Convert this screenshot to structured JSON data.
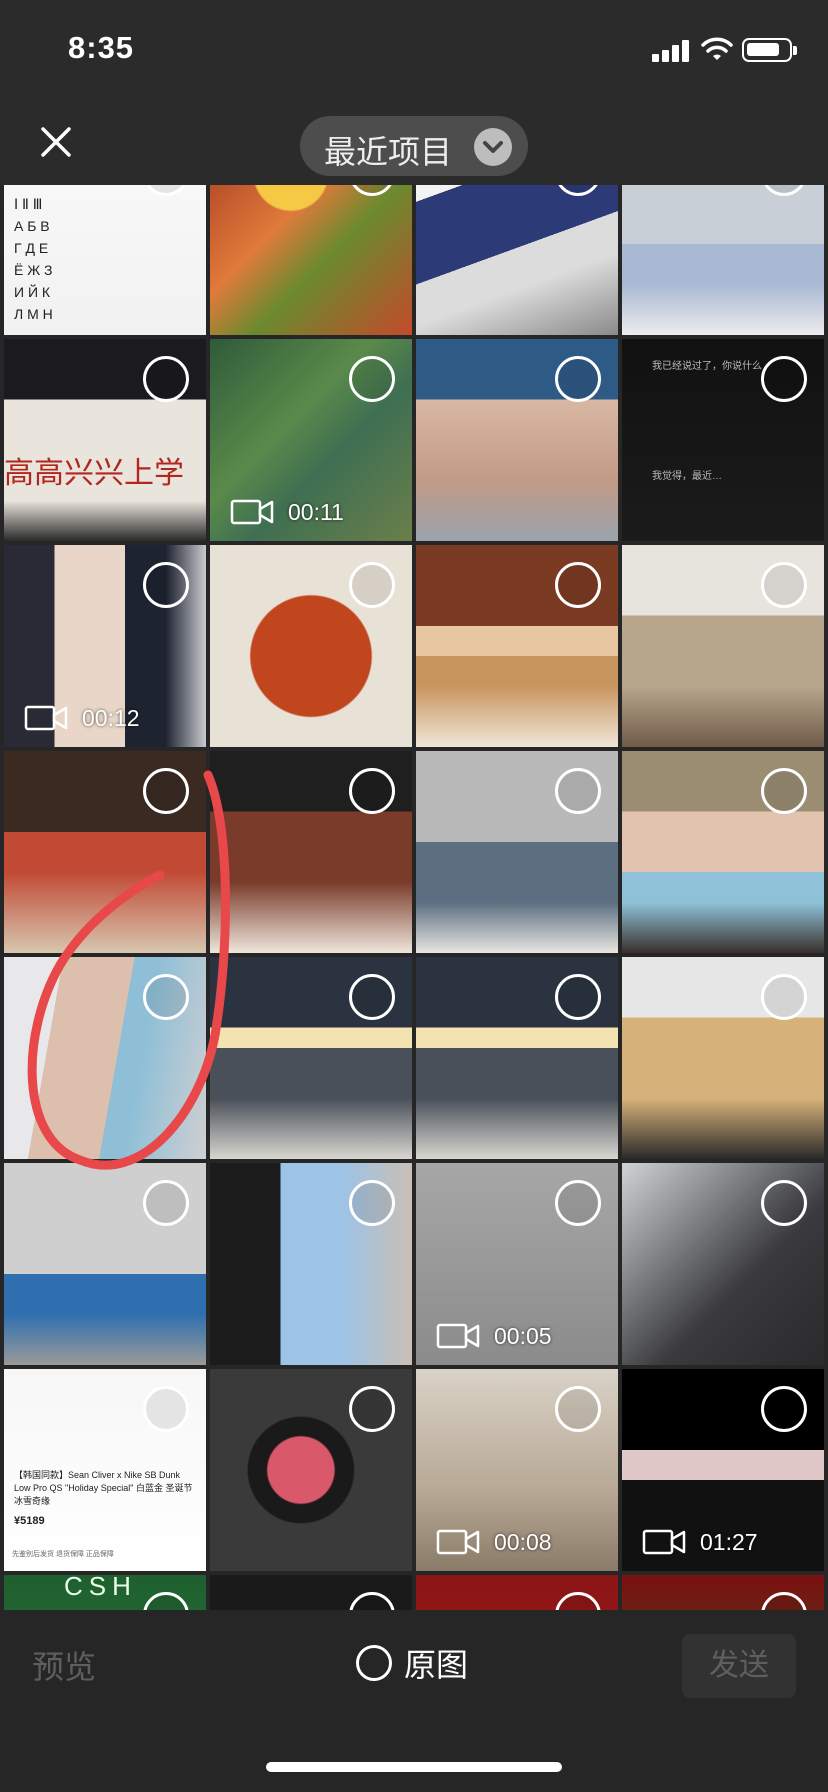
{
  "status_bar": {
    "time": "8:35"
  },
  "nav": {
    "album_title": "最近项目"
  },
  "grid": {
    "row1": [
      "letters-chart",
      "food-platter",
      "sneaker-box",
      "sneakers-plush"
    ],
    "cells": [
      {
        "r": 1,
        "c": 0,
        "kind": "letters-chart",
        "video": null
      },
      {
        "r": 1,
        "c": 1,
        "kind": "game-map",
        "video": "00:11"
      },
      {
        "r": 1,
        "c": 2,
        "kind": "hand-ring",
        "video": null
      },
      {
        "r": 1,
        "c": 3,
        "kind": "chat-screenshot",
        "video": null
      },
      {
        "r": 2,
        "c": 0,
        "kind": "selfie-girl",
        "video": "00:12"
      },
      {
        "r": 2,
        "c": 1,
        "kind": "spaghetti",
        "video": null
      },
      {
        "r": 2,
        "c": 2,
        "kind": "tiramisu",
        "video": null
      },
      {
        "r": 2,
        "c": 3,
        "kind": "showroom",
        "video": null
      },
      {
        "r": 3,
        "c": 0,
        "kind": "christmas-shelf",
        "video": null
      },
      {
        "r": 3,
        "c": 1,
        "kind": "christmas-dining",
        "video": null
      },
      {
        "r": 3,
        "c": 2,
        "kind": "living-room",
        "video": null
      },
      {
        "r": 3,
        "c": 3,
        "kind": "masked-selfie",
        "video": null
      },
      {
        "r": 4,
        "c": 0,
        "kind": "masked-selfie-tilted",
        "video": null
      },
      {
        "r": 4,
        "c": 1,
        "kind": "dining-table",
        "video": null
      },
      {
        "r": 4,
        "c": 2,
        "kind": "dining-table-2",
        "video": null
      },
      {
        "r": 4,
        "c": 3,
        "kind": "kitchen-utensils",
        "video": null
      },
      {
        "r": 5,
        "c": 0,
        "kind": "shopping-cart",
        "video": null
      },
      {
        "r": 5,
        "c": 1,
        "kind": "plush-toy",
        "video": null
      },
      {
        "r": 5,
        "c": 2,
        "kind": "shadow",
        "video": "00:05"
      },
      {
        "r": 5,
        "c": 3,
        "kind": "plush-bear",
        "video": null
      },
      {
        "r": 6,
        "c": 0,
        "kind": "product-page",
        "video": null
      },
      {
        "r": 6,
        "c": 1,
        "kind": "watch",
        "video": null
      },
      {
        "r": 6,
        "c": 2,
        "kind": "shoe-wall",
        "video": "00:08"
      },
      {
        "r": 6,
        "c": 3,
        "kind": "dark-video",
        "video": "01:27"
      },
      {
        "r": 7,
        "c": 0,
        "kind": "csh-sign",
        "video": null
      },
      {
        "r": 7,
        "c": 1,
        "kind": "red-ornament",
        "video": null
      },
      {
        "r": 7,
        "c": 2,
        "kind": "red-room",
        "video": null
      },
      {
        "r": 7,
        "c": 3,
        "kind": "xmas-tree",
        "video": null
      }
    ],
    "letters_chart_text": "Ⅰ Ⅱ Ⅲ\nА Б В\nГ Д Е\nЁ Ж З\nИ Й К\nЛ М Н",
    "game_map_hint": "",
    "sign_text": "高高兴兴上学",
    "product_text": "【韩国同款】Sean Cliver x Nike SB Dunk Low Pro QS \"Holiday Special\" 白蓝金 圣诞节 冰雪奇缘",
    "product_price": "¥5189",
    "product_footer": [
      "先鉴别后发货",
      "退货保障",
      "正品保障"
    ],
    "csh_text": "CSH",
    "chat_lines": [
      "我已经说过了，你说什么",
      "我觉得，最近…"
    ]
  },
  "bottom": {
    "preview_label": "预览",
    "original_label": "原图",
    "send_label": "发送"
  },
  "colors": {
    "background": "#262626",
    "nav": "#2b2b2b",
    "highlight_stroke": "#e8484a",
    "disabled_text": "#5f5f5f"
  }
}
